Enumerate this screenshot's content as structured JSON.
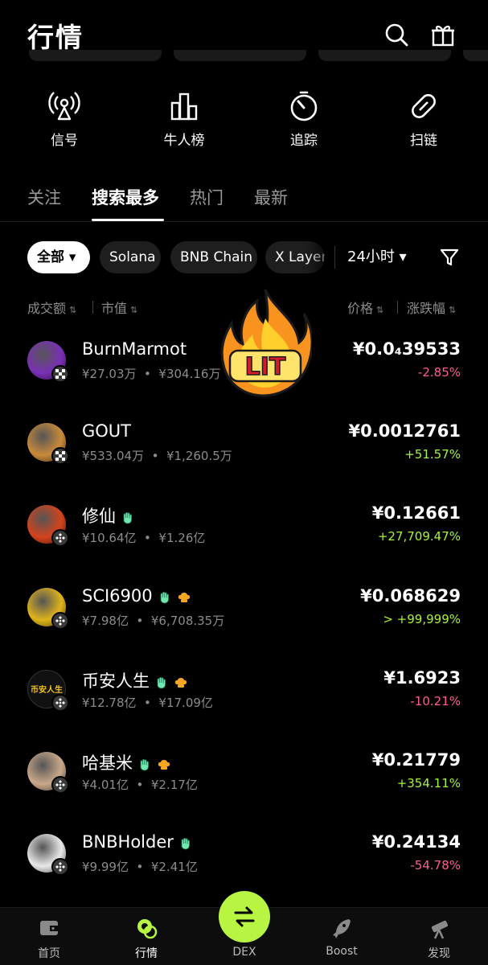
{
  "header": {
    "title": "行情",
    "search_icon": "search-icon",
    "gift_icon": "gift-icon"
  },
  "shortcuts": [
    {
      "label": "信号",
      "icon": "broadcast-icon"
    },
    {
      "label": "牛人榜",
      "icon": "bar-chart-icon"
    },
    {
      "label": "追踪",
      "icon": "target-icon"
    },
    {
      "label": "扫链",
      "icon": "link-icon"
    }
  ],
  "tabs": [
    {
      "label": "关注",
      "active": false
    },
    {
      "label": "搜索最多",
      "active": true
    },
    {
      "label": "热门",
      "active": false
    },
    {
      "label": "最新",
      "active": false
    }
  ],
  "chips": [
    {
      "label": "全部 ▾",
      "active": true
    },
    {
      "label": "Solana",
      "active": false
    },
    {
      "label": "BNB Chain",
      "active": false
    },
    {
      "label": "X Layer",
      "active": false
    }
  ],
  "time_select": "24小时 ▾",
  "sort_headers": {
    "volume": "成交额",
    "market_cap": "市值",
    "price": "价格",
    "change": "涨跌幅"
  },
  "sticker_text": "LIT",
  "tokens": [
    {
      "name": "BurnMarmot",
      "volume": "¥27.03万",
      "market_cap": "¥304.16万",
      "price": "¥0.0₄39533",
      "change": "-2.85%",
      "direction": "down",
      "avatar_color": "#7a2fb5",
      "chain": "xlayer",
      "badges": []
    },
    {
      "name": "GOUT",
      "volume": "¥533.04万",
      "market_cap": "¥1,260.5万",
      "price": "¥0.0012761",
      "change": "+51.57%",
      "direction": "up",
      "avatar_color": "#c98a3a",
      "chain": "xlayer",
      "badges": []
    },
    {
      "name": "修仙",
      "volume": "¥10.64亿",
      "market_cap": "¥1.26亿",
      "price": "¥0.12661",
      "change": "+27,709.47%",
      "direction": "up",
      "avatar_color": "#d4431c",
      "chain": "bnb",
      "badges": [
        "hand"
      ]
    },
    {
      "name": "SCI6900",
      "volume": "¥7.98亿",
      "market_cap": "¥6,708.35万",
      "price": "¥0.068629",
      "change": "> +99,999%",
      "direction": "up",
      "avatar_color": "#e0b31a",
      "chain": "bnb",
      "badges": [
        "hand",
        "chef"
      ]
    },
    {
      "name": "币安人生",
      "volume": "¥12.78亿",
      "market_cap": "¥17.09亿",
      "price": "¥1.6923",
      "change": "-10.21%",
      "direction": "down",
      "avatar_color": "#111111",
      "avatar_text": "币安人生",
      "chain": "bnb",
      "badges": [
        "hand",
        "chef"
      ]
    },
    {
      "name": "哈基米",
      "volume": "¥4.01亿",
      "market_cap": "¥2.17亿",
      "price": "¥0.21779",
      "change": "+354.11%",
      "direction": "up",
      "avatar_color": "#c9a88a",
      "chain": "bnb",
      "badges": [
        "hand",
        "chef"
      ]
    },
    {
      "name": "BNBHolder",
      "volume": "¥9.99亿",
      "market_cap": "¥2.41亿",
      "price": "¥0.24134",
      "change": "-54.78%",
      "direction": "down",
      "avatar_color": "#e8e8e8",
      "chain": "bnb",
      "badges": [
        "hand"
      ]
    }
  ],
  "bottom_nav": [
    {
      "label": "首页",
      "icon": "wallet-icon"
    },
    {
      "label": "行情",
      "icon": "market-icon",
      "active": true
    },
    {
      "label": "DEX",
      "icon": "swap-icon"
    },
    {
      "label": "Boost",
      "icon": "rocket-icon"
    },
    {
      "label": "发现",
      "icon": "telescope-icon"
    }
  ]
}
